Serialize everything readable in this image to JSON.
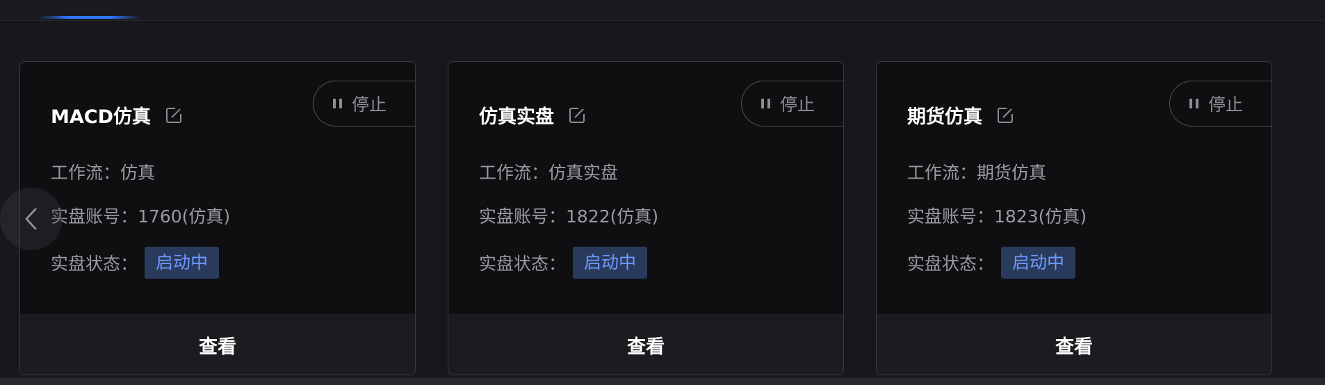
{
  "cards": [
    {
      "name": "MACD仿真",
      "stop_label": "停止",
      "workflow_label": "工作流：",
      "workflow_value": "仿真",
      "account_label": "实盘账号：",
      "account_value": "1760(仿真)",
      "status_label": "实盘状态：",
      "status_value": "启动中",
      "view_label": "查看"
    },
    {
      "name": "仿真实盘",
      "stop_label": "停止",
      "workflow_label": "工作流：",
      "workflow_value": "仿真实盘",
      "account_label": "实盘账号：",
      "account_value": "1822(仿真)",
      "status_label": "实盘状态：",
      "status_value": "启动中",
      "view_label": "查看"
    },
    {
      "name": "期货仿真",
      "stop_label": "停止",
      "workflow_label": "工作流：",
      "workflow_value": "期货仿真",
      "account_label": "实盘账号：",
      "account_value": "1823(仿真)",
      "status_label": "实盘状态：",
      "status_value": "启动中",
      "view_label": "查看"
    }
  ],
  "icons": {
    "edit": "edit-icon",
    "pause": "pause-icon",
    "prev": "chevron-left-icon"
  },
  "colors": {
    "accent": "#2f78ff",
    "status_bg": "#2a3a5c",
    "status_text": "#6b9bff"
  }
}
